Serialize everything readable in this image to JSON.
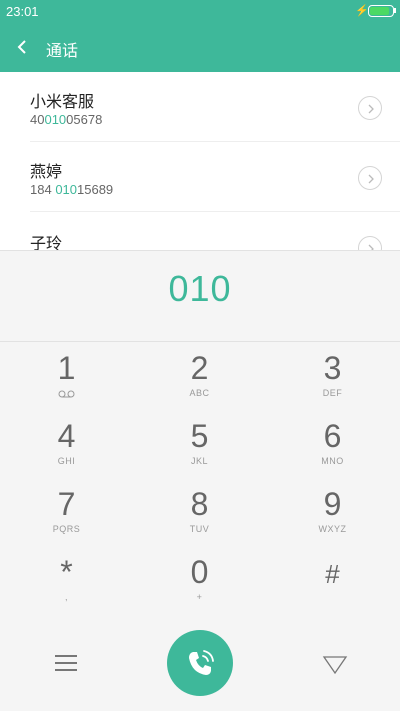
{
  "status_bar": {
    "time": "23:01",
    "bolt": "⚡"
  },
  "header": {
    "title": "通话"
  },
  "contacts": [
    {
      "name": "小米客服",
      "number_pre": "40",
      "number_match": "010",
      "number_post": "05678"
    },
    {
      "name": "燕婷",
      "number_pre": "184 ",
      "number_match": "010",
      "number_post": "15689"
    },
    {
      "name": "子玲",
      "number_pre": "",
      "number_match": "",
      "number_post": ""
    }
  ],
  "dialer": {
    "dialed": "010"
  },
  "keypad": [
    {
      "digit": "1",
      "letters": ""
    },
    {
      "digit": "2",
      "letters": "ABC"
    },
    {
      "digit": "3",
      "letters": "DEF"
    },
    {
      "digit": "4",
      "letters": "GHI"
    },
    {
      "digit": "5",
      "letters": "JKL"
    },
    {
      "digit": "6",
      "letters": "MNO"
    },
    {
      "digit": "7",
      "letters": "PQRS"
    },
    {
      "digit": "8",
      "letters": "TUV"
    },
    {
      "digit": "9",
      "letters": "WXYZ"
    },
    {
      "digit": "*",
      "letters": ","
    },
    {
      "digit": "0",
      "letters": "+"
    },
    {
      "digit": "#",
      "letters": ""
    }
  ],
  "colors": {
    "accent": "#3eb89a",
    "battery": "#4cd964"
  },
  "icons": [
    "back-icon",
    "chevron-right-icon",
    "voicemail-icon",
    "menu-icon",
    "phone-call-icon",
    "collapse-triangle-icon"
  ]
}
